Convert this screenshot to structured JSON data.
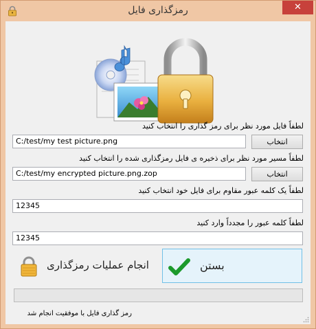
{
  "window": {
    "title": "رمزگذاری فایل",
    "close_glyph": "✕",
    "accent_color": "#f0c7a5"
  },
  "icons": {
    "app": "lock-icon",
    "hero": "media-files-and-padlock",
    "encrypt": "padlock-icon",
    "close": "checkmark-icon"
  },
  "source": {
    "label": "لطفاً فایل مورد نظر برای رمز گذاری را انتخاب کنید",
    "value": "C:/test/my test picture.png",
    "button_label": "انتخاب"
  },
  "destination": {
    "label": "لطفاً مسیر مورد نظر برای ذخیره ی فایل رمزگذاری شده را انتخاب کنید",
    "value": "C:/test/my encrypted picture.png.zop",
    "button_label": "انتخاب"
  },
  "password": {
    "label": "لطفاً یک کلمه عبور مقاوم برای فایل خود انتخاب کنید",
    "value": "12345"
  },
  "confirm_password": {
    "label": "لطفاً کلمه عبور را مجدداً وارد کنید",
    "value": "12345"
  },
  "actions": {
    "encrypt_label": "انجام عملیات رمزگذاری",
    "close_label": "بستن"
  },
  "progress": {
    "value": 0
  },
  "status": {
    "text": "رمز گذاری فایل با موفقیت انجام شد"
  }
}
